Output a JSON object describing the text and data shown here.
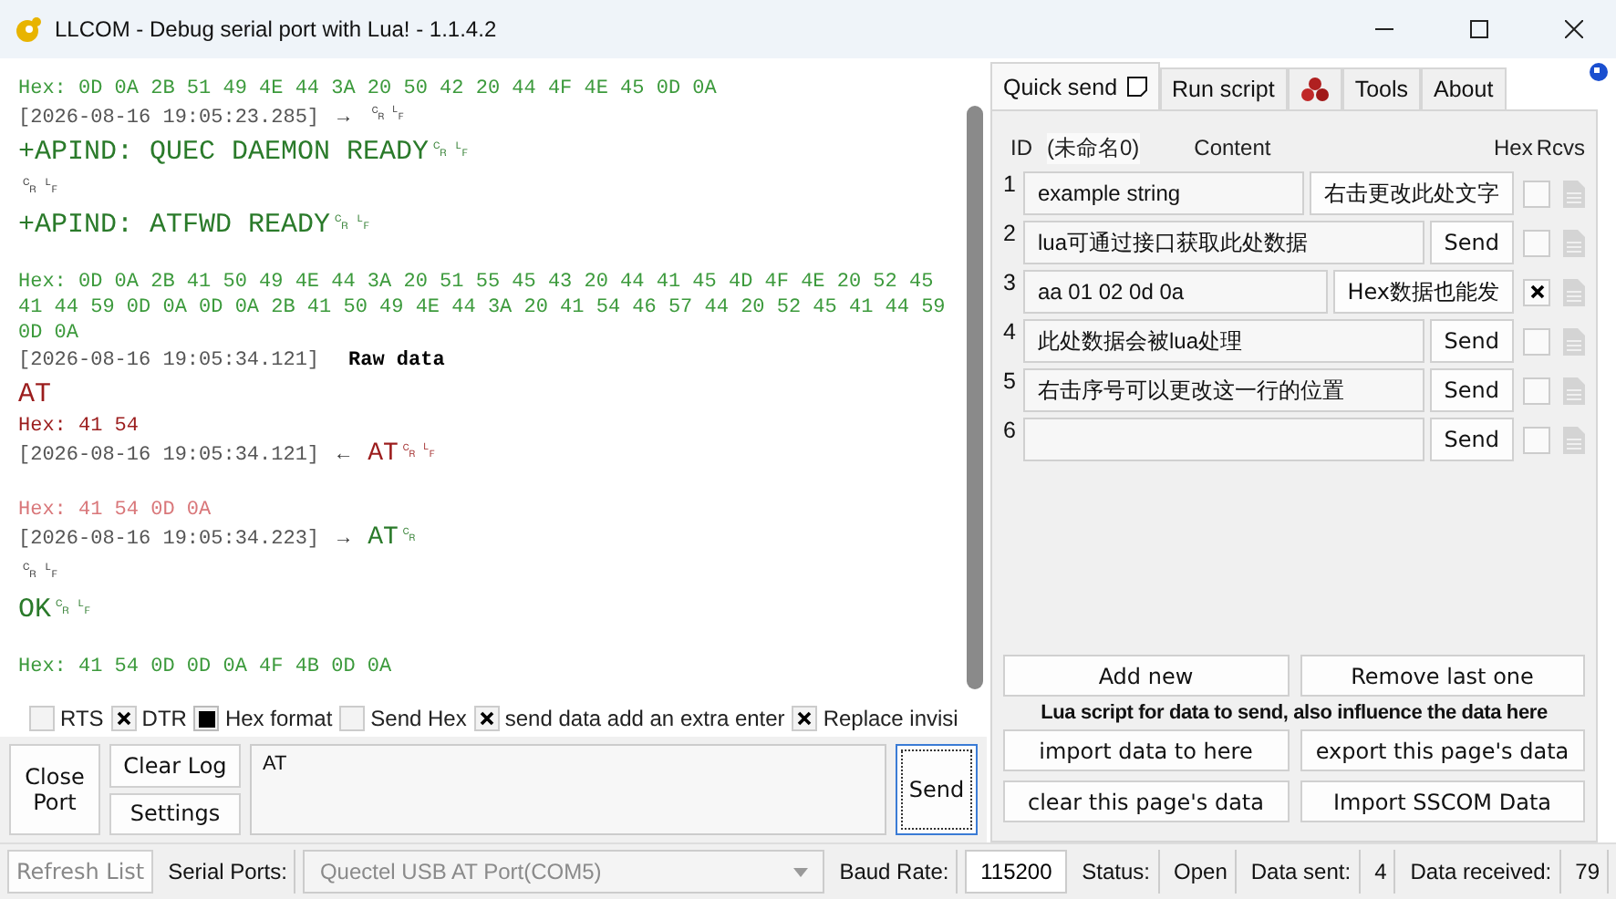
{
  "window": {
    "title": "LLCOM - Debug serial port with Lua! - 1.1.4.2"
  },
  "log": [
    {
      "kind": "hex",
      "text": "Hex: 0D 0A 2B 51 49 4E 44 3A 20 50 42 20 44 4F 4E 45 0D 0A",
      "color": "#3c9a3c"
    },
    {
      "kind": "stamp",
      "time": "[2026-08-16 19:05:23.285]",
      "arrow": "→",
      "payload": "␍␊"
    },
    {
      "kind": "data",
      "text": "+APIND: QUEC DAEMON READY␍␊",
      "color": "#2a7a2a"
    },
    {
      "kind": "data",
      "text": "␍␊"
    },
    {
      "kind": "data",
      "text": "+APIND: ATFWD READY␍␊",
      "color": "#2a7a2a"
    },
    {
      "kind": "gap"
    },
    {
      "kind": "hex",
      "text": "Hex: 0D 0A 2B 41 50 49 4E 44 3A 20 51 55 45 43 20 44 41 45 4D 4F 4E 20 52 45 41 44 59 0D 0A 0D 0A 2B 41 50 49 4E 44 3A 20 41 54 46 57 44 20 52 45 41 44 59 0D 0A",
      "color": "#3c9a3c"
    },
    {
      "kind": "raw",
      "time": "[2026-08-16 19:05:34.121]",
      "payload": "Raw data"
    },
    {
      "kind": "data",
      "text": "AT",
      "color": "#9b1c1c"
    },
    {
      "kind": "hex",
      "text": "Hex: 41 54",
      "color": "#9b1c1c"
    },
    {
      "kind": "stamp",
      "time": "[2026-08-16 19:05:34.121]",
      "arrow": "←",
      "payload": "AT␍␊",
      "color": "#9b1c1c"
    },
    {
      "kind": "gap"
    },
    {
      "kind": "hex",
      "text": "Hex: 41 54 0D 0A",
      "color": "#d9777a"
    },
    {
      "kind": "stamp",
      "time": "[2026-08-16 19:05:34.223]",
      "arrow": "→",
      "payload": "AT␍",
      "color": "#2a7a2a"
    },
    {
      "kind": "data",
      "text": "␍␊"
    },
    {
      "kind": "data",
      "text": "OK␍␊",
      "color": "#2a7a2a"
    },
    {
      "kind": "gap"
    },
    {
      "kind": "hex",
      "text": "Hex: 41 54 0D 0D 0A 4F 4B 0D 0A",
      "color": "#3c9a3c"
    }
  ],
  "options": [
    {
      "kind": "cross",
      "label": "RTS",
      "checked": false
    },
    {
      "kind": "cross",
      "label": "DTR",
      "checked": true
    },
    {
      "kind": "square",
      "label": "Hex format",
      "checked": true
    },
    {
      "kind": "cross",
      "label": "Send Hex",
      "checked": false
    },
    {
      "kind": "cross",
      "label": "send data add an extra enter",
      "checked": true
    },
    {
      "kind": "cross",
      "label": "Replace invisi",
      "checked": true
    }
  ],
  "controls": {
    "close_port": "Close Port",
    "clear_log": "Clear Log",
    "settings": "Settings",
    "send_text": "AT",
    "send": "Send"
  },
  "tabs": [
    {
      "kind": "text",
      "label": "Quick send",
      "selected": true
    },
    {
      "kind": "text",
      "label": "Run script",
      "selected": false
    },
    {
      "kind": "icon",
      "selected": false
    },
    {
      "kind": "text",
      "label": "Tools",
      "selected": false
    },
    {
      "kind": "text",
      "label": "About",
      "selected": false
    }
  ],
  "quick_send": {
    "headers": {
      "id": "ID",
      "name": "(未命名0)",
      "content": "Content",
      "hex": "Hex",
      "rcvs": "Rcvs"
    },
    "rows": [
      {
        "id": "1",
        "content": "example string",
        "button": "右击更改此处文字",
        "hex": false
      },
      {
        "id": "2",
        "content": "lua可通过接口获取此处数据",
        "button": "Send",
        "hex": false
      },
      {
        "id": "3",
        "content": "aa 01 02 0d 0a",
        "button": "Hex数据也能发",
        "hex": true
      },
      {
        "id": "4",
        "content": "此处数据会被lua处理",
        "button": "Send",
        "hex": false
      },
      {
        "id": "5",
        "content": "右击序号可以更改这一行的位置",
        "button": "Send",
        "hex": false
      },
      {
        "id": "6",
        "content": "",
        "button": "Send",
        "hex": false
      }
    ],
    "add": "Add new",
    "remove": "Remove last one",
    "note": "Lua script for data to send, also influence the data here",
    "actions": [
      "import data to here",
      "export this page's data",
      "clear this page's data",
      "Import SSCOM Data"
    ]
  },
  "status_bar": {
    "refresh": "Refresh List",
    "ports_label": "Serial Ports:",
    "port": "Quectel USB AT Port(COM5)",
    "baud_label": "Baud Rate:",
    "baud": "115200",
    "status_label": "Status:",
    "status": "Open",
    "sent_label": "Data sent:",
    "sent": "4",
    "received_label": "Data received:",
    "received": "79"
  }
}
